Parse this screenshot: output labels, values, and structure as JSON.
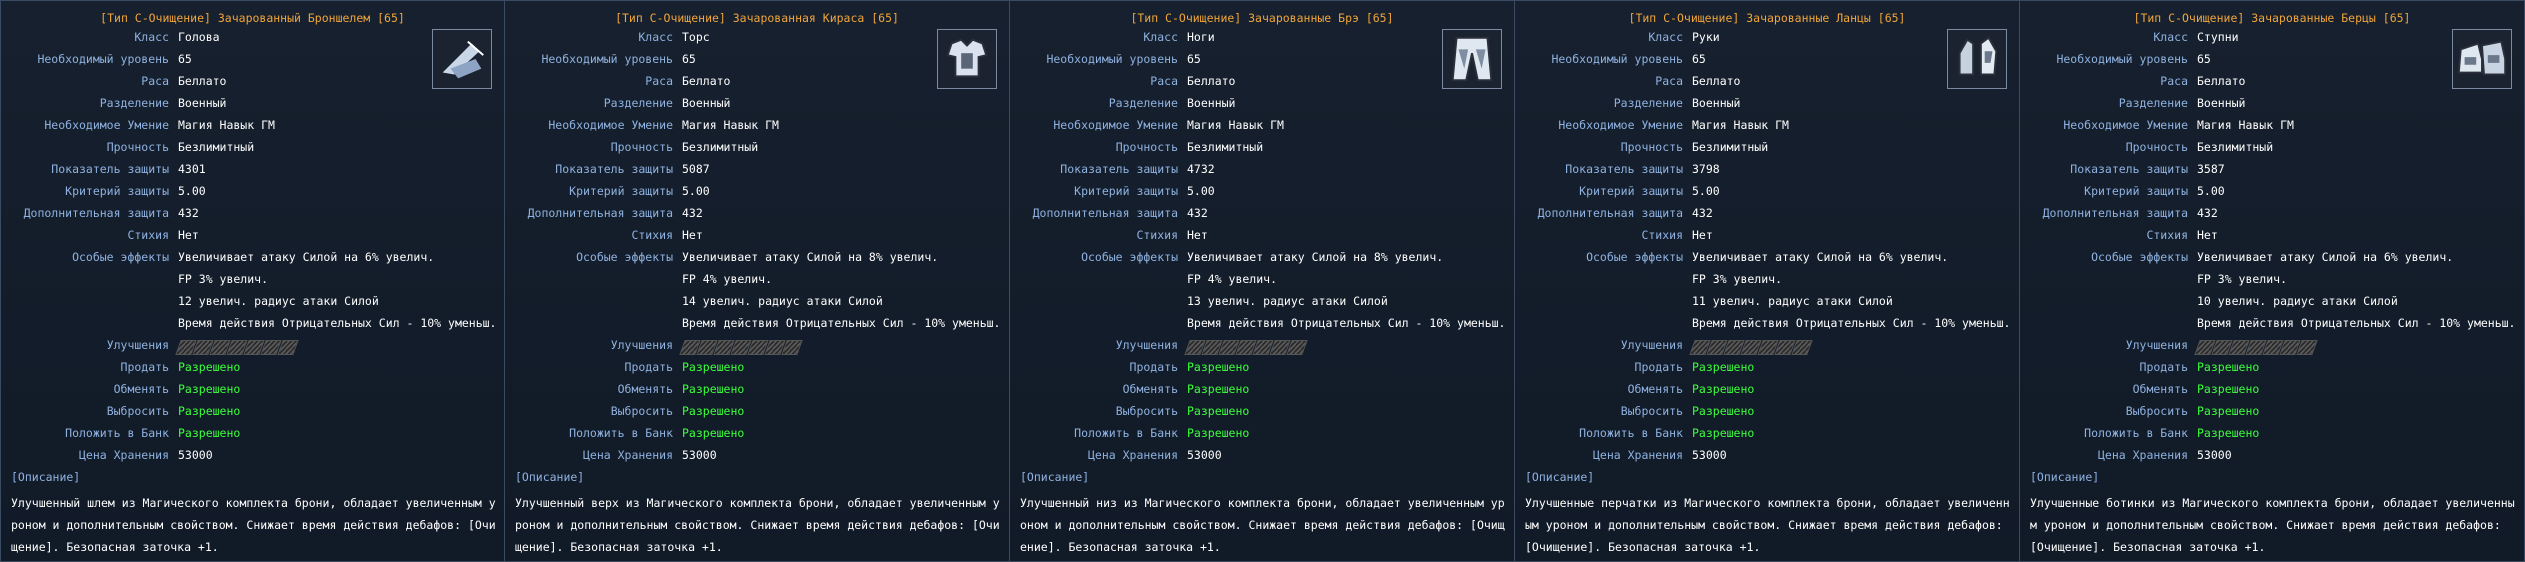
{
  "labels": {
    "class": "Класс",
    "level": "Необходимый уровень",
    "race": "Раса",
    "division": "Разделение",
    "skill": "Необходимое Умение",
    "durability": "Прочность",
    "defense": "Показатель защиты",
    "crit": "Критерий защиты",
    "extra": "Дополнительная защита",
    "element": "Стихия",
    "effects": "Особые эффекты",
    "upgrades": "Улучшения",
    "sell": "Продать",
    "trade": "Обменять",
    "drop": "Выбросить",
    "bank": "Положить в Банк",
    "price": "Цена Хранения",
    "desc_header": "[Описание]"
  },
  "items": [
    {
      "title": "[Тип С-Очищение] Зачарованный Броншелем [65]",
      "icon": "helmet-icon",
      "class": "Голова",
      "level": "65",
      "race": "Беллато",
      "division": "Военный",
      "skill": "Магия Навык ГМ",
      "durability": "Безлимитный",
      "defense": "4301",
      "crit": "5.00",
      "extra": "432",
      "element": "Нет",
      "effects": [
        "Увеличивает атаку Силой на 6% увелич.",
        "FP 3% увелич.",
        "12 увелич. радиус атаки Силой",
        "Время действия Отрицательных Сил - 10% уменьш."
      ],
      "sell": "Разрешено",
      "trade": "Разрешено",
      "drop": "Разрешено",
      "bank": "Разрешено",
      "price": "53000",
      "description": "Улучшенный шлем из Магического комплекта брони, обладает увеличенным уроном и дополнительным свойством. Снижает время действия дебафов: [Очищение]. Безопасная заточка +1."
    },
    {
      "title": "[Тип С-Очищение] Зачарованная Кираса [65]",
      "icon": "armor-icon",
      "class": "Торс",
      "level": "65",
      "race": "Беллато",
      "division": "Военный",
      "skill": "Магия Навык ГМ",
      "durability": "Безлимитный",
      "defense": "5087",
      "crit": "5.00",
      "extra": "432",
      "element": "Нет",
      "effects": [
        "Увеличивает атаку Силой на 8% увелич.",
        "FP 4% увелич.",
        "14 увелич. радиус атаки Силой",
        "Время действия Отрицательных Сил - 10% уменьш."
      ],
      "sell": "Разрешено",
      "trade": "Разрешено",
      "drop": "Разрешено",
      "bank": "Разрешено",
      "price": "53000",
      "description": "Улучшенный верх из Магического комплекта брони, обладает увеличенным уроном и дополнительным свойством. Снижает время действия дебафов: [Очищение]. Безопасная заточка +1."
    },
    {
      "title": "[Тип С-Очищение] Зачарованные Брэ [65]",
      "icon": "pants-icon",
      "class": "Ноги",
      "level": "65",
      "race": "Беллато",
      "division": "Военный",
      "skill": "Магия Навык ГМ",
      "durability": "Безлимитный",
      "defense": "4732",
      "crit": "5.00",
      "extra": "432",
      "element": "Нет",
      "effects": [
        "Увеличивает атаку Силой на 8% увелич.",
        "FP 4% увелич.",
        "13 увелич. радиус атаки Силой",
        "Время действия Отрицательных Сил - 10% уменьш."
      ],
      "sell": "Разрешено",
      "trade": "Разрешено",
      "drop": "Разрешено",
      "bank": "Разрешено",
      "price": "53000",
      "description": "Улучшенный низ из Магического комплекта брони, обладает увеличенным уроном и дополнительным свойством. Снижает время действия дебафов: [Очищение]. Безопасная заточка +1."
    },
    {
      "title": "[Тип С-Очищение] Зачарованные Ланцы [65]",
      "icon": "gloves-icon",
      "class": "Руки",
      "level": "65",
      "race": "Беллато",
      "division": "Военный",
      "skill": "Магия Навык ГМ",
      "durability": "Безлимитный",
      "defense": "3798",
      "crit": "5.00",
      "extra": "432",
      "element": "Нет",
      "effects": [
        "Увеличивает атаку Силой на 6% увелич.",
        "FP 3% увелич.",
        "11 увелич. радиус атаки Силой",
        "Время действия Отрицательных Сил - 10% уменьш."
      ],
      "sell": "Разрешено",
      "trade": "Разрешено",
      "drop": "Разрешено",
      "bank": "Разрешено",
      "price": "53000",
      "description": "Улучшенные перчатки из Магического комплекта брони, обладает увеличенным уроном и дополнительным свойством. Снижает время действия дебафов: [Очищение]. Безопасная заточка +1."
    },
    {
      "title": "[Тип С-Очищение] Зачарованные Берцы [65]",
      "icon": "boots-icon",
      "class": "Ступни",
      "level": "65",
      "race": "Беллато",
      "division": "Военный",
      "skill": "Магия Навык ГМ",
      "durability": "Безлимитный",
      "defense": "3587",
      "crit": "5.00",
      "extra": "432",
      "element": "Нет",
      "effects": [
        "Увеличивает атаку Силой на 6% увелич.",
        "FP 3% увелич.",
        "10 увелич. радиус атаки Силой",
        "Время действия Отрицательных Сил - 10% уменьш."
      ],
      "sell": "Разрешено",
      "trade": "Разрешено",
      "drop": "Разрешено",
      "bank": "Разрешено",
      "price": "53000",
      "description": "Улучшенные ботинки из Магического комплекта брони, обладает увеличенным уроном и дополнительным свойством. Снижает время действия дебафов: [Очищение]. Безопасная заточка +1."
    }
  ]
}
